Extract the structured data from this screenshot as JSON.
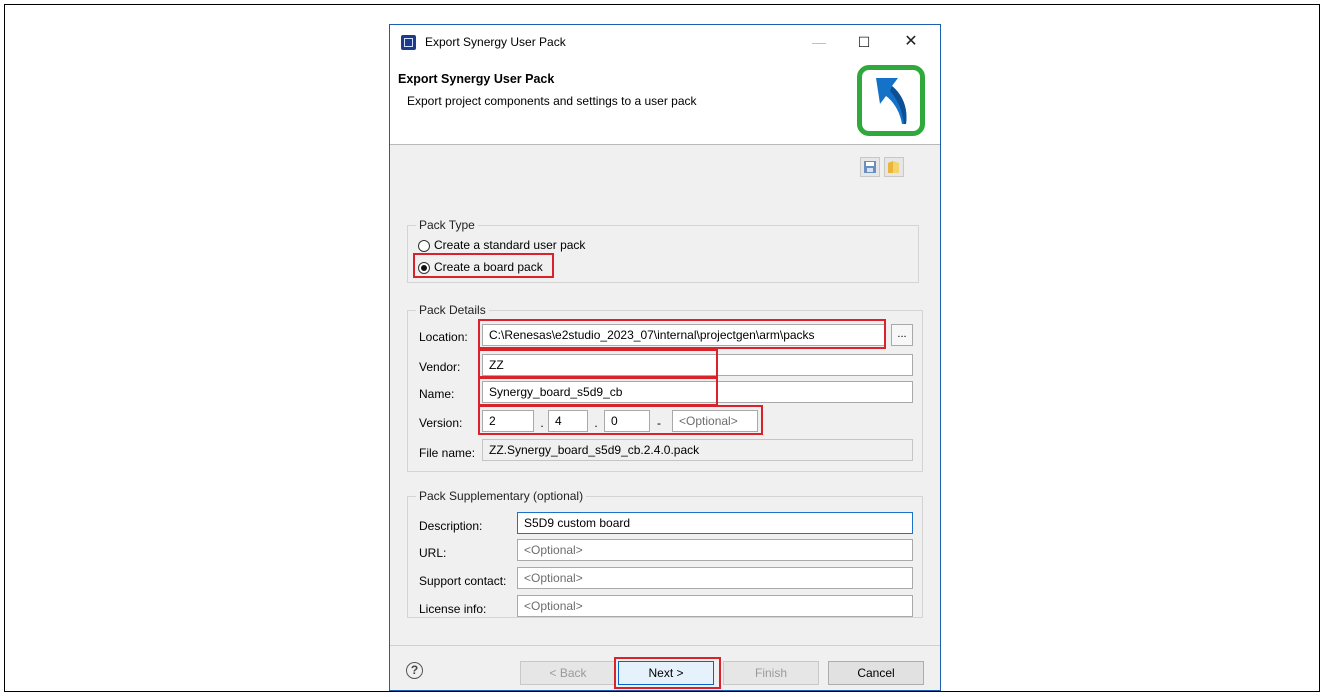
{
  "window": {
    "title": "Export Synergy User Pack",
    "minimize": "—",
    "maximize": "☐",
    "close": "✕"
  },
  "header": {
    "title": "Export Synergy User Pack",
    "subtitle": "Export project components and settings to a user pack"
  },
  "pack_type": {
    "title": "Pack Type",
    "options": [
      {
        "label": "Create a standard user pack",
        "selected": false
      },
      {
        "label": "Create a board pack",
        "selected": true
      }
    ]
  },
  "pack_details": {
    "title": "Pack Details",
    "location_label": "Location:",
    "location_value": "C:\\Renesas\\e2studio_2023_07\\internal\\projectgen\\arm\\packs",
    "browse_label": "...",
    "vendor_label": "Vendor:",
    "vendor_value": "ZZ",
    "name_label": "Name:",
    "name_value": "Synergy_board_s5d9_cb",
    "version_label": "Version:",
    "version": {
      "major": "2",
      "minor": "4",
      "patch": "0",
      "suffix_placeholder": "<Optional>",
      "sep_dot": ".",
      "sep_dash": "-"
    },
    "filename_label": "File name:",
    "filename_value": "ZZ.Synergy_board_s5d9_cb.2.4.0.pack"
  },
  "pack_supplementary": {
    "title": "Pack Supplementary  (optional)",
    "description_label": "Description:",
    "description_value": "S5D9 custom board",
    "url_label": "URL:",
    "url_placeholder": "<Optional>",
    "support_label": "Support contact:",
    "support_placeholder": "<Optional>",
    "license_label": "License info:",
    "license_placeholder": "<Optional>"
  },
  "footer": {
    "help": "?",
    "back_label": "< Back",
    "next_label": "Next >",
    "finish_label": "Finish",
    "cancel_label": "Cancel"
  },
  "colors": {
    "highlight": "#d9222a",
    "logo_frame": "#2fa93c",
    "logo_arrow": "#1473c8",
    "focus": "#0b62c8"
  }
}
